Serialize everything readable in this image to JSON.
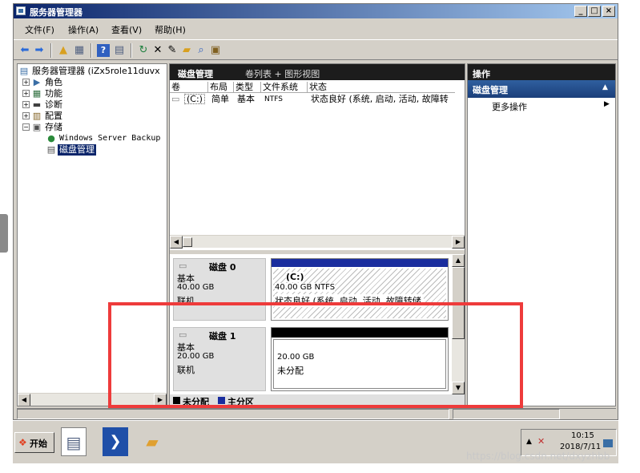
{
  "window": {
    "title": "服务器管理器",
    "minimize": "_",
    "maximize": "□",
    "close": "×"
  },
  "menu": [
    "文件(F)",
    "操作(A)",
    "查看(V)",
    "帮助(H)"
  ],
  "tree": {
    "root": "服务器管理器 (iZx5role11duvx",
    "items": [
      "角色",
      "功能",
      "诊断",
      "配置",
      "存储"
    ],
    "children": [
      "Windows Server Backup",
      "磁盘管理"
    ]
  },
  "center": {
    "tab_active": "磁盘管理",
    "tab_view": "卷列表 + 图形视图",
    "columns": [
      "卷",
      "布局",
      "类型",
      "文件系统",
      "状态"
    ],
    "row": {
      "volume": "(C:)",
      "layout": "简单",
      "type": "基本",
      "fs": "NTFS",
      "status": "状态良好 (系统, 启动, 活动, 故障转"
    },
    "disks": [
      {
        "name": "磁盘 0",
        "type": "基本",
        "size": "40.00 GB",
        "state": "联机",
        "volume": {
          "label": "(C:)",
          "size": "40.00 GB NTFS",
          "status": "状态良好 (系统, 启动, 活动, 故障转储,"
        }
      },
      {
        "name": "磁盘 1",
        "type": "基本",
        "size": "20.00 GB",
        "state": "联机",
        "volume": {
          "size": "20.00 GB",
          "status": "未分配"
        }
      }
    ],
    "legend": [
      "未分配",
      "主分区"
    ]
  },
  "actions": {
    "header": "操作",
    "section": "磁盘管理",
    "more": "更多操作"
  },
  "taskbar": {
    "start": "开始",
    "time": "10:15",
    "date": "2018/7/11"
  },
  "watermark": "https://blog.csdn.net/dxyzhbb",
  "colors": {
    "unallocated": "#000000",
    "primary": "#1a2d9e",
    "accent": "#0a246a"
  }
}
